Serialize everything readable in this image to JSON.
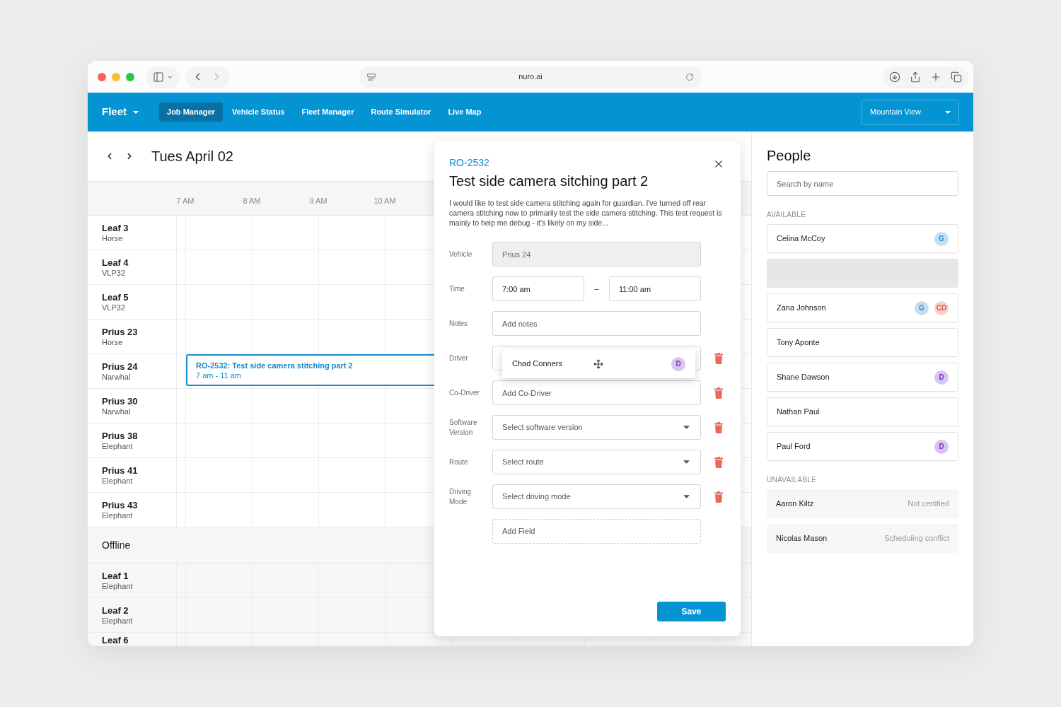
{
  "browser": {
    "url": "nuro.ai",
    "back_enabled": true,
    "forward_enabled": false
  },
  "nav": {
    "brand": "Fleet",
    "tabs": [
      {
        "label": "Job Manager",
        "selected": true
      },
      {
        "label": "Vehicle Status",
        "selected": false
      },
      {
        "label": "Fleet Manager",
        "selected": false
      },
      {
        "label": "Route Simulator",
        "selected": false
      },
      {
        "label": "Live Map",
        "selected": false
      }
    ],
    "location": "Mountain View"
  },
  "calendar": {
    "date": "Tues April 02",
    "hours": [
      "7 AM",
      "8 AM",
      "9 AM",
      "10 AM"
    ],
    "vehicles": [
      {
        "name": "Leaf 3",
        "model": "Horse"
      },
      {
        "name": "Leaf 4",
        "model": "VLP32"
      },
      {
        "name": "Leaf 5",
        "model": "VLP32"
      },
      {
        "name": "Prius 23",
        "model": "Horse"
      },
      {
        "name": "Prius 24",
        "model": "Narwhal",
        "event": {
          "title": "RO-2532: Test side camera stitching part 2",
          "time": "7 am - 11 am"
        }
      },
      {
        "name": "Prius 30",
        "model": "Narwhal"
      },
      {
        "name": "Prius 38",
        "model": "Elephant"
      },
      {
        "name": "Prius 41",
        "model": "Elephant"
      },
      {
        "name": "Prius 43",
        "model": "Elephant"
      }
    ],
    "offline": {
      "title": "Offline",
      "vehicles": [
        {
          "name": "Leaf 1",
          "model": "Elephant"
        },
        {
          "name": "Leaf 2",
          "model": "Elephant"
        },
        {
          "name": "Leaf 6"
        }
      ]
    }
  },
  "job_dialog": {
    "id": "RO-2532",
    "title": "Test side camera sitching part 2",
    "description": "I would like to test side camera stitching again for guardian. I've turned off rear camera stitching now to primarily test the side camera stitching. This test request is mainly to help me debug - it's likely on my side...",
    "fields": [
      {
        "kind": "text",
        "label": "Vehicle",
        "value": "Prius 24",
        "disabled": true,
        "removable": false
      },
      {
        "kind": "time_range",
        "label": "Time",
        "start": "7:00 am",
        "separator": "–",
        "end": "11:00 am",
        "disabled": false,
        "removable": false
      },
      {
        "kind": "text",
        "label": "Notes",
        "placeholder": "Add notes",
        "disabled": false,
        "removable": false
      },
      {
        "kind": "person",
        "label": "Driver",
        "dragged": {
          "name": "Chad Conners",
          "badges": [
            {
              "text": "D",
              "color": "#7b2fc9"
            }
          ]
        },
        "disabled": false,
        "removable": true
      },
      {
        "kind": "text",
        "label": "Co-Driver",
        "placeholder": "Add Co-Driver",
        "disabled": false,
        "removable": true
      },
      {
        "kind": "select",
        "label": "Software Version",
        "placeholder": "Select software version",
        "disabled": false,
        "removable": true
      },
      {
        "kind": "select",
        "label": "Route",
        "placeholder": "Select route",
        "disabled": false,
        "removable": true
      },
      {
        "kind": "select",
        "label": "Driving Mode",
        "placeholder": "Select driving mode",
        "disabled": false,
        "removable": true
      }
    ],
    "add_field": "Add Field",
    "save": "Save"
  },
  "people": {
    "title": "People",
    "search_placeholder": "Search by name",
    "groups": [
      {
        "title": "AVAILABLE",
        "items": [
          {
            "kind": "person",
            "name": "Celina McCoy",
            "badges": [
              {
                "text": "G",
                "color": "#2f8ccc"
              }
            ]
          },
          {
            "kind": "placeholder"
          },
          {
            "kind": "person",
            "name": "Zana Johnson",
            "badges": [
              {
                "text": "G",
                "color": "#2f8ccc"
              },
              {
                "text": "CD",
                "color": "#e0604c"
              }
            ]
          },
          {
            "kind": "person",
            "name": "Tony Aponte"
          },
          {
            "kind": "person",
            "name": "Shane Dawson",
            "badges": [
              {
                "text": "D",
                "color": "#7b2fc9"
              }
            ]
          },
          {
            "kind": "person",
            "name": "Nathan Paul"
          },
          {
            "kind": "person",
            "name": "Paul Ford",
            "badges": [
              {
                "text": "D",
                "color": "#7b2fc9"
              }
            ]
          }
        ]
      },
      {
        "title": "UNAVAILABLE",
        "items": [
          {
            "kind": "unavailable",
            "name": "Aaron Kiltz",
            "reason": "Not certified"
          },
          {
            "kind": "unavailable",
            "name": "Nicolas Mason",
            "reason": "Scheduling conflict"
          }
        ]
      }
    ]
  }
}
